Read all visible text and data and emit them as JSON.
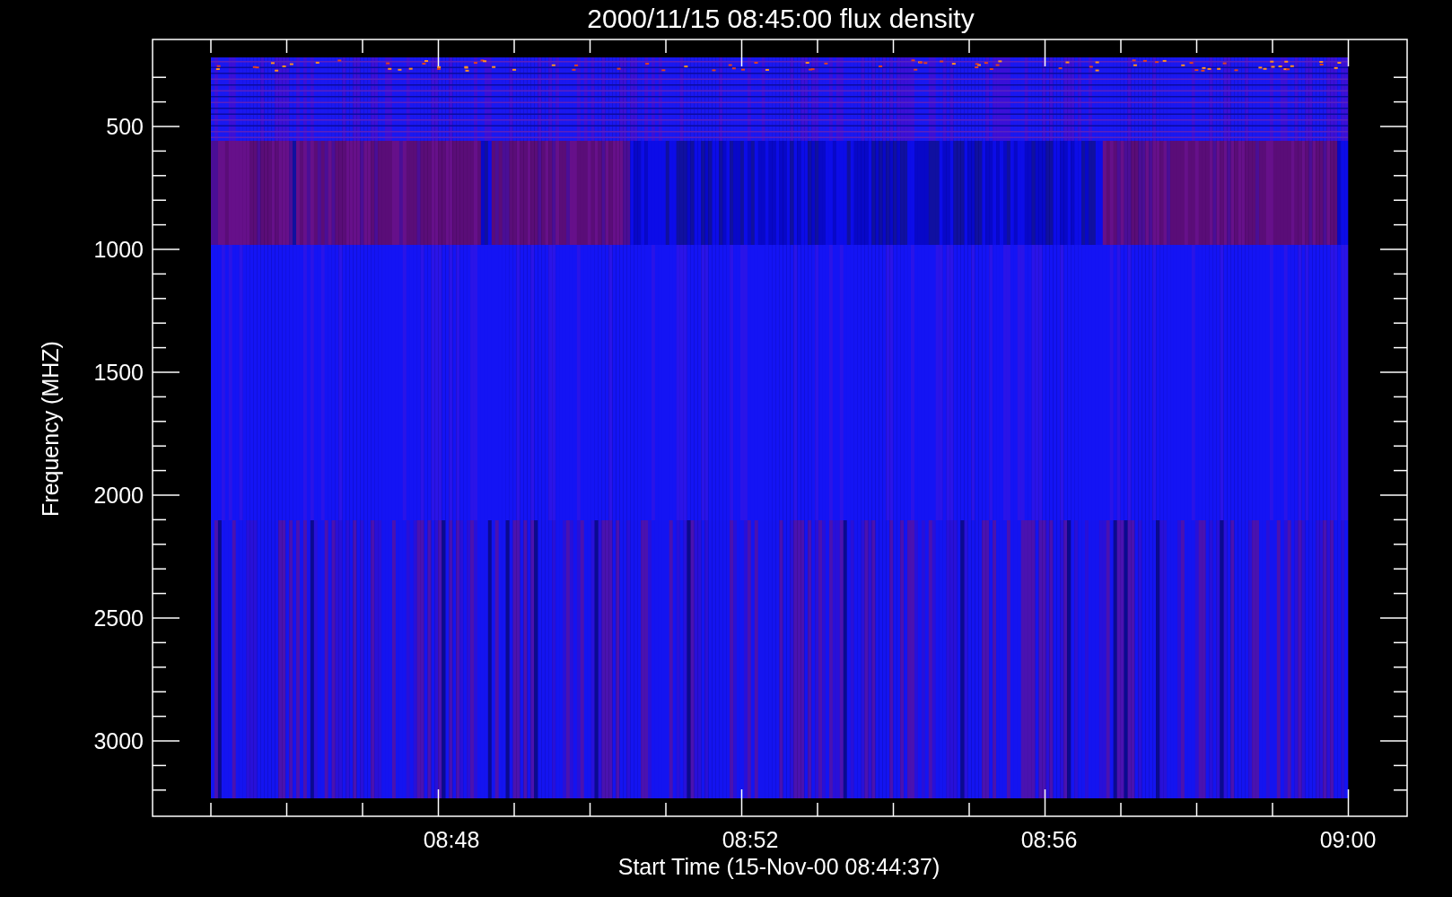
{
  "plot": {
    "title": "2000/11/15 08:45:00 flux density",
    "ylabel": "Frequency (MHZ)",
    "xlabel": "Start Time (15-Nov-00 08:44:37)",
    "yticks": [
      "500",
      "1000",
      "1500",
      "2000",
      "2500",
      "3000"
    ],
    "xticks": [
      "08:48",
      "08:52",
      "08:56",
      "09:00"
    ]
  }
}
